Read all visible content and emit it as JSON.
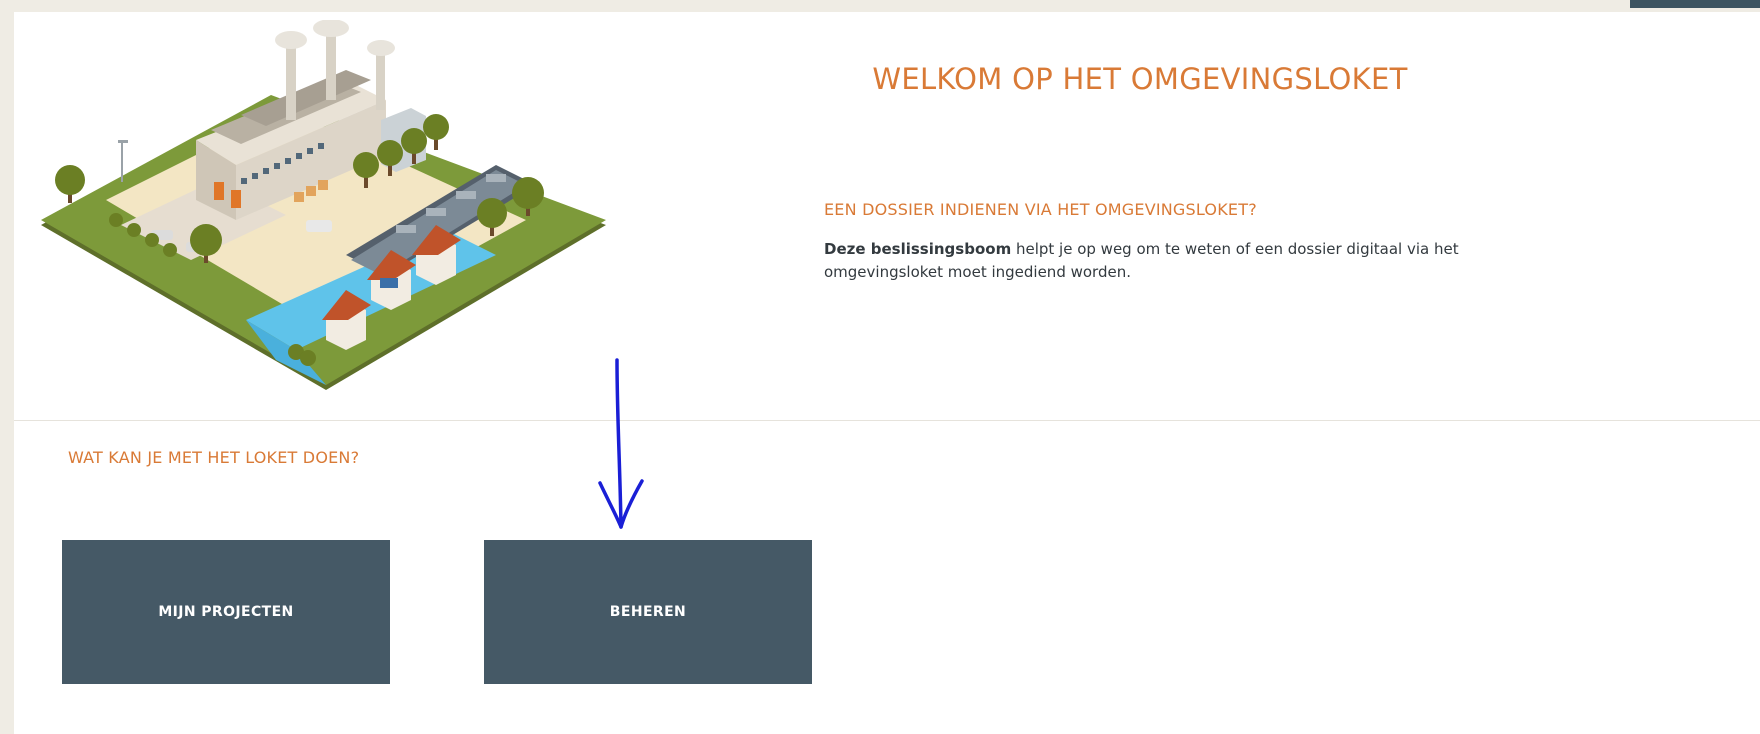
{
  "header": {
    "title": "WELKOM OP HET OMGEVINGSLOKET"
  },
  "intro": {
    "heading": "EEN DOSSIER INDIENEN VIA HET OMGEVINGSLOKET?",
    "bold_text": "Deze beslissingsboom",
    "body_text": " helpt je op weg om te weten of een dossier digitaal via het omgevingsloket moet ingediend worden."
  },
  "actions": {
    "heading": "WAT KAN JE MET HET LOKET DOEN?",
    "tiles": [
      {
        "label": "MIJN PROJECTEN"
      },
      {
        "label": "BEHEREN"
      }
    ]
  },
  "colors": {
    "accent": "#d97a36",
    "tile": "#455966",
    "background": "#efece4",
    "annotation": "#1a1fd6"
  },
  "icons": {
    "illustration": "industrial-site-illustration",
    "annotation": "hand-drawn-arrow-down"
  }
}
